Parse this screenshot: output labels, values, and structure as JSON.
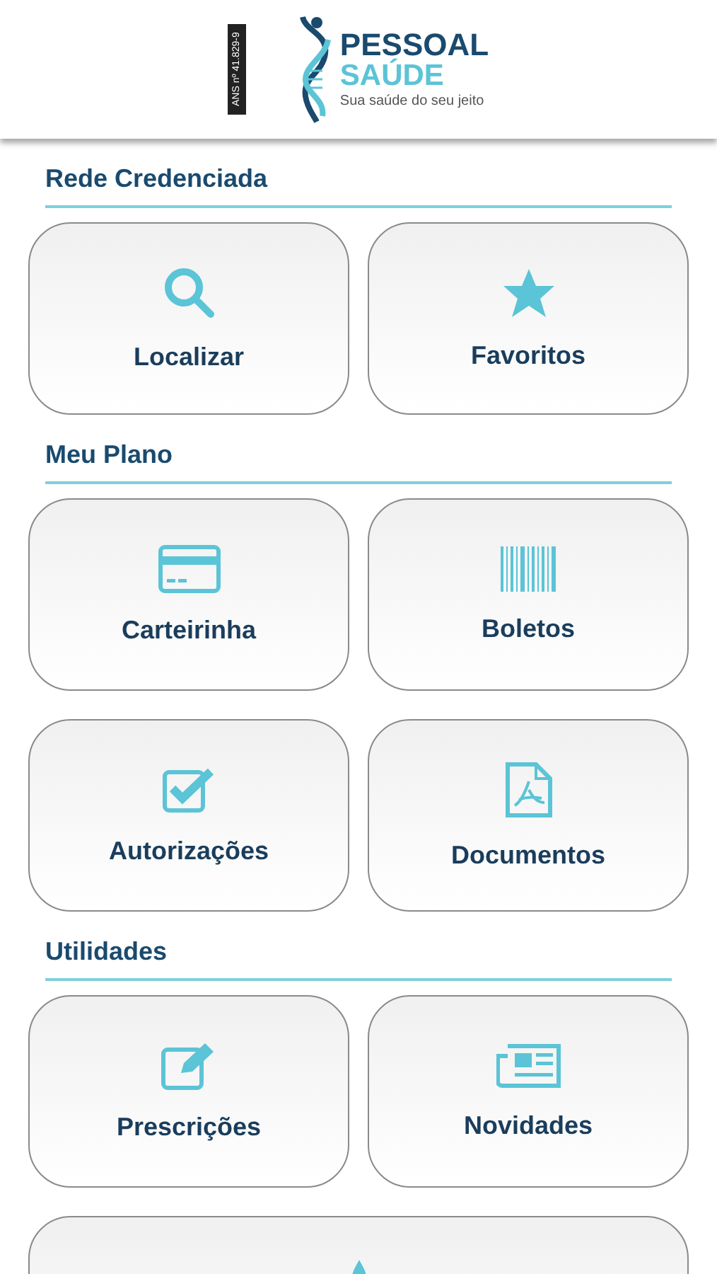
{
  "header": {
    "registration": "ANS nº 41.829-9",
    "logo": {
      "line1": "PESSOAL",
      "line2": "SAÚDE",
      "tagline": "Sua saúde do seu jeito"
    }
  },
  "sections": [
    {
      "title": "Rede Credenciada",
      "items": [
        {
          "label": "Localizar",
          "kind": "search"
        },
        {
          "label": "Favoritos",
          "kind": "star"
        }
      ]
    },
    {
      "title": "Meu Plano",
      "items": [
        {
          "label": "Carteirinha",
          "kind": "card"
        },
        {
          "label": "Boletos",
          "kind": "barcode"
        },
        {
          "label": "Autorizações",
          "kind": "check"
        },
        {
          "label": "Documentos",
          "kind": "pdf"
        }
      ]
    },
    {
      "title": "Utilidades",
      "items": [
        {
          "label": "Prescrições",
          "kind": "edit"
        },
        {
          "label": "Novidades",
          "kind": "news"
        },
        {
          "kind": "drop",
          "wide": true
        }
      ]
    }
  ]
}
